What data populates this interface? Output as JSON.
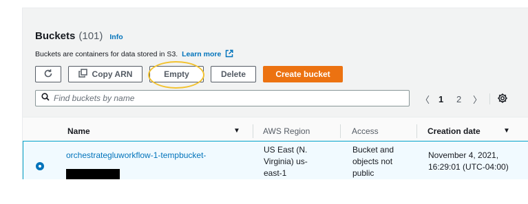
{
  "header": {
    "title": "Buckets",
    "count": "(101)",
    "info": "Info",
    "description": "Buckets are containers for data stored in S3.",
    "learn_more": "Learn more"
  },
  "toolbar": {
    "refresh_icon": "refresh-icon",
    "copy_arn_label": "Copy ARN",
    "empty_label": "Empty",
    "delete_label": "Delete",
    "create_label": "Create bucket",
    "primary_color": "#ec7211"
  },
  "search": {
    "placeholder": "Find buckets by name",
    "value": ""
  },
  "pagination": {
    "pages": [
      "1",
      "2"
    ],
    "current": "1",
    "prev_symbol": "〈",
    "next_symbol": "〉"
  },
  "table": {
    "columns": [
      "Name",
      "AWS Region",
      "Access",
      "Creation date"
    ],
    "rows": [
      {
        "name": "orchestrategluworkflow-1-tempbucket-",
        "region": "US East (N. Virginia) us-east-1",
        "region_lines": [
          "US East (N.",
          "Virginia) us-",
          "east-1"
        ],
        "access_lines": [
          "Bucket and",
          "objects not",
          "public"
        ],
        "creation_lines": [
          "November 4, 2021,",
          "16:29:01 (UTC-04:00)"
        ],
        "selected": true
      }
    ]
  },
  "colors": {
    "link": "#0073bb",
    "highlight": "#f2c230",
    "selection_border": "#00a1c9"
  }
}
